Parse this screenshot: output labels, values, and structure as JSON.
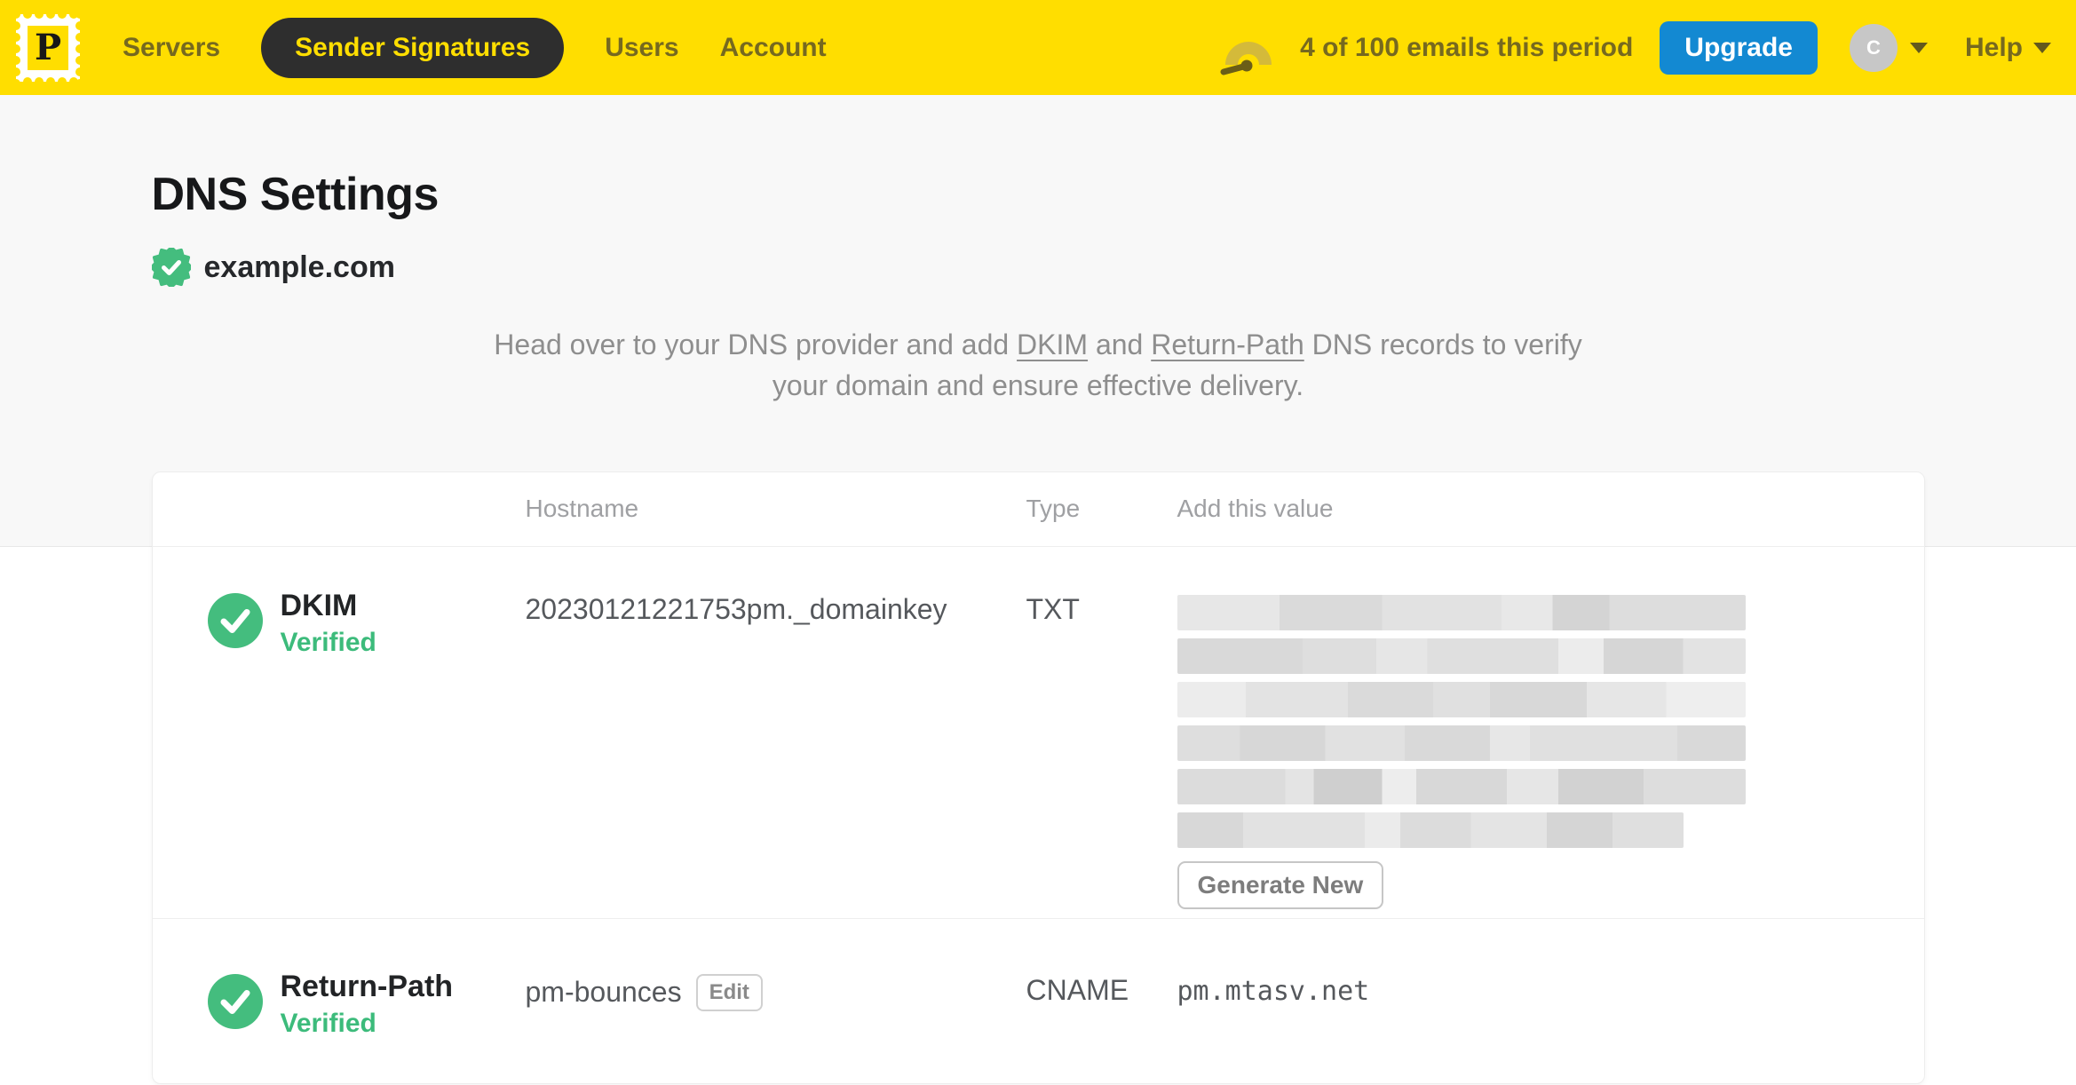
{
  "colors": {
    "brand_yellow": "#FFDE00",
    "accent_blue": "#1389D2",
    "success_green": "#44BD7E",
    "nav_text_olive": "#76691F"
  },
  "nav": {
    "logo_letter": "P",
    "items": [
      {
        "label": "Servers",
        "active": false
      },
      {
        "label": "Sender Signatures",
        "active": true
      },
      {
        "label": "Users",
        "active": false
      },
      {
        "label": "Account",
        "active": false
      }
    ],
    "usage_text": "4 of 100 emails this period",
    "upgrade_label": "Upgrade",
    "avatar_initial": "C",
    "help_label": "Help"
  },
  "page": {
    "title": "DNS Settings",
    "domain": "example.com",
    "intro": {
      "part1": "Head over to your DNS provider and add ",
      "link_dkim": "DKIM",
      "part2": " and ",
      "link_return_path": "Return-Path",
      "part3": " DNS records to verify your domain and ensure effective delivery."
    }
  },
  "table": {
    "headers": {
      "hostname": "Hostname",
      "type": "Type",
      "value": "Add this value"
    },
    "rows": [
      {
        "name": "DKIM",
        "status": "Verified",
        "hostname": "20230121221753pm._domainkey",
        "type": "TXT",
        "value_redacted": true,
        "action_label": "Generate New"
      },
      {
        "name": "Return-Path",
        "status": "Verified",
        "hostname": "pm-bounces",
        "hostname_action": "Edit",
        "type": "CNAME",
        "value": "pm.mtasv.net"
      }
    ]
  }
}
